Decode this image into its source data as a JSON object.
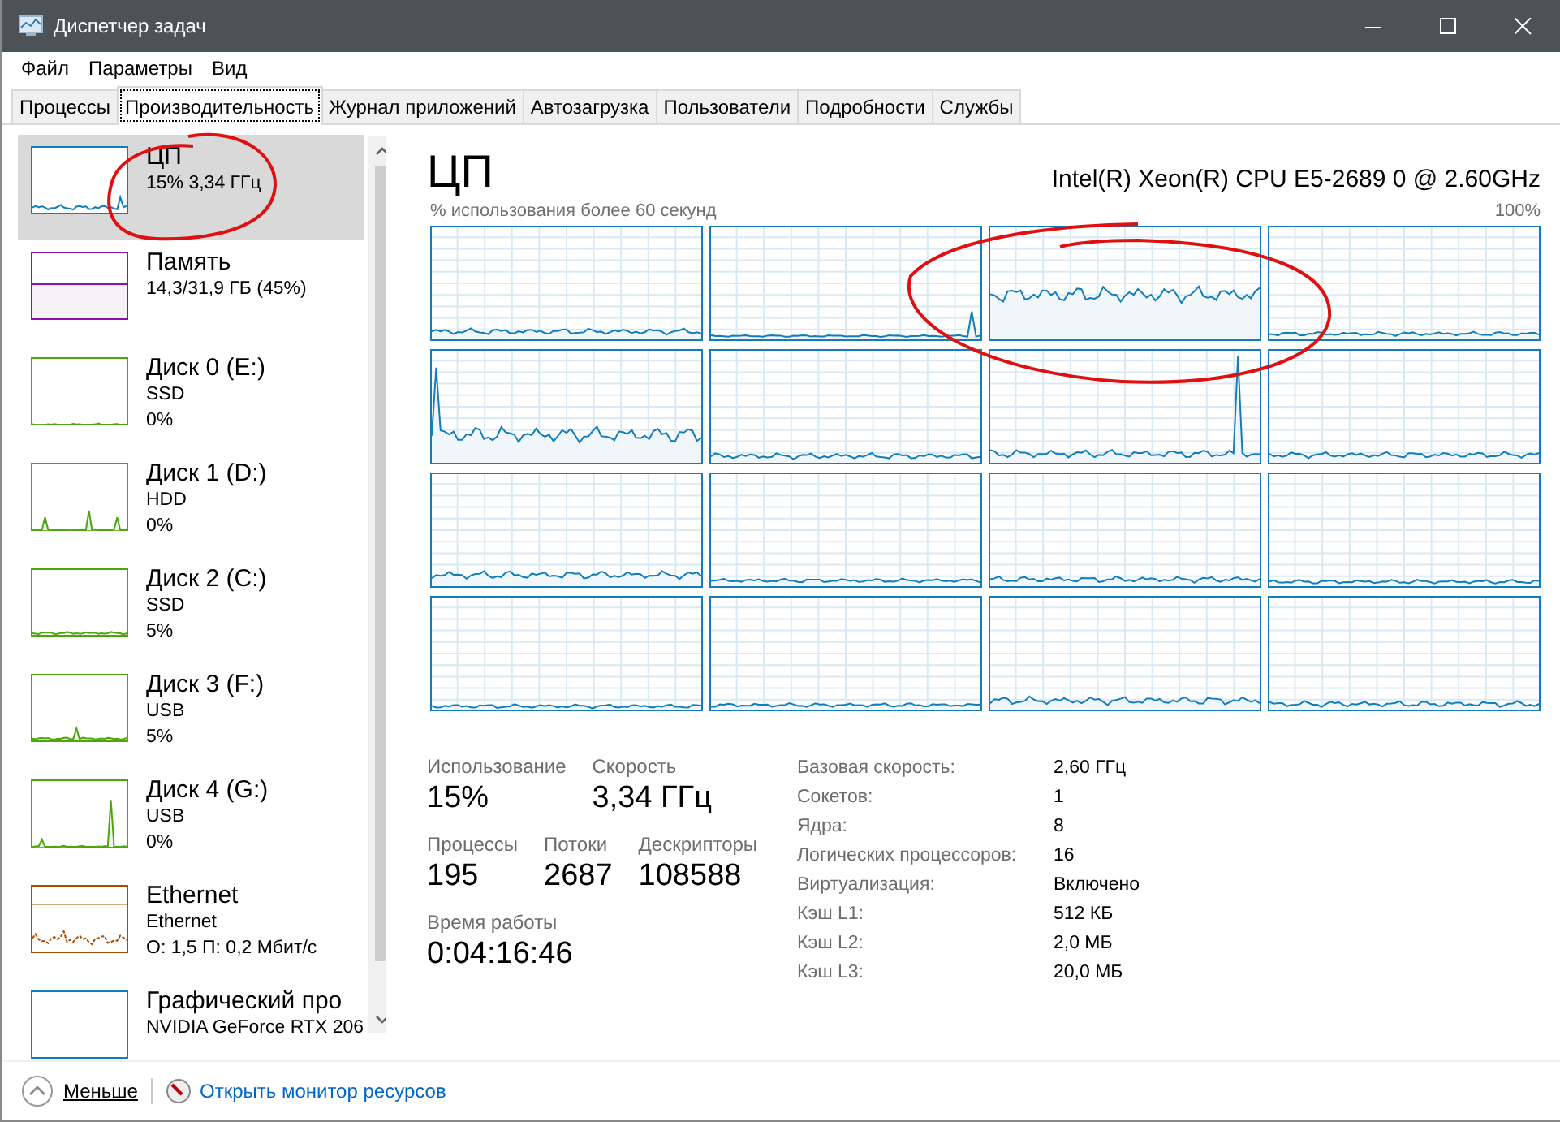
{
  "window": {
    "title": "Диспетчер задач"
  },
  "menu": [
    "Файл",
    "Параметры",
    "Вид"
  ],
  "tabs": [
    {
      "label": "Процессы",
      "selected": false
    },
    {
      "label": "Производительность",
      "selected": true
    },
    {
      "label": "Журнал приложений",
      "selected": false
    },
    {
      "label": "Автозагрузка",
      "selected": false
    },
    {
      "label": "Пользователи",
      "selected": false
    },
    {
      "label": "Подробности",
      "selected": false
    },
    {
      "label": "Службы",
      "selected": false
    }
  ],
  "sidebar": {
    "items": [
      {
        "kind": "cpu",
        "name": "ЦП",
        "detail": "15% 3,34 ГГц",
        "selected": true
      },
      {
        "kind": "memory",
        "name": "Память",
        "detail": "14,3/31,9 ГБ (45%)",
        "selected": false
      },
      {
        "kind": "disk",
        "name": "Диск 0 (E:)",
        "type": "SSD",
        "detail": "0%",
        "selected": false
      },
      {
        "kind": "disk",
        "name": "Диск 1 (D:)",
        "type": "HDD",
        "detail": "0%",
        "selected": false
      },
      {
        "kind": "disk",
        "name": "Диск 2 (C:)",
        "type": "SSD",
        "detail": "5%",
        "selected": false
      },
      {
        "kind": "disk",
        "name": "Диск 3 (F:)",
        "type": "USB",
        "detail": "5%",
        "selected": false
      },
      {
        "kind": "disk",
        "name": "Диск 4 (G:)",
        "type": "USB",
        "detail": "0%",
        "selected": false
      },
      {
        "kind": "network",
        "name": "Ethernet",
        "type": "Ethernet",
        "detail": "О: 1,5 П: 0,2 Мбит/с",
        "selected": false
      },
      {
        "kind": "gpu",
        "name": "Графический про",
        "type": "NVIDIA GeForce RTX 206",
        "selected": false
      }
    ]
  },
  "panel": {
    "title": "ЦП",
    "model": "Intel(R) Xeon(R) CPU E5-2689 0 @ 2.60GHz",
    "graph_caption": "% использования более 60 секунд",
    "graph_max": "100%",
    "stats": [
      [
        {
          "label": "Использование",
          "value": "15%"
        },
        {
          "label": "Скорость",
          "value": "3,34 ГГц"
        }
      ],
      [
        {
          "label": "Процессы",
          "value": "195"
        },
        {
          "label": "Потоки",
          "value": "2687"
        },
        {
          "label": "Дескрипторы",
          "value": "108588"
        }
      ],
      [
        {
          "label": "Время работы",
          "value": "0:04:16:46"
        }
      ]
    ],
    "specs": [
      {
        "label": "Базовая скорость:",
        "value": "2,60 ГГц"
      },
      {
        "label": "Сокетов:",
        "value": "1"
      },
      {
        "label": "Ядра:",
        "value": "8"
      },
      {
        "label": "Логических процессоров:",
        "value": "16"
      },
      {
        "label": "Виртуализация:",
        "value": "Включено"
      },
      {
        "label": "Кэш L1:",
        "value": "512 КБ"
      },
      {
        "label": "Кэш L2:",
        "value": "2,0 МБ"
      },
      {
        "label": "Кэш L3:",
        "value": "20,0 МБ"
      }
    ]
  },
  "footer": {
    "less": "Меньше",
    "monitor_link": "Открыть монитор ресурсов"
  }
}
